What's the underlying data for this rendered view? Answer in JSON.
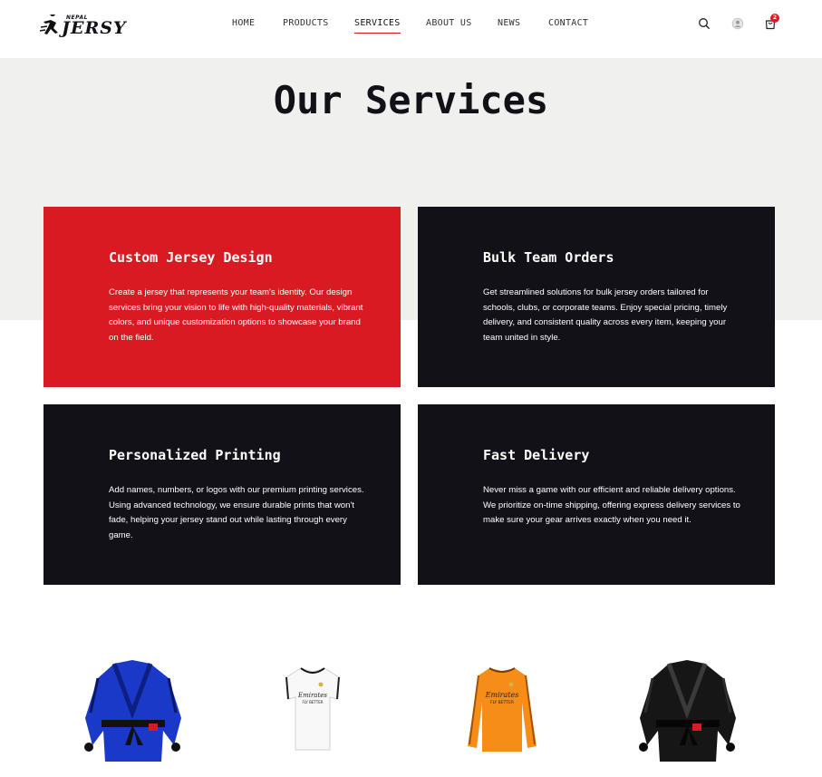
{
  "header": {
    "logo": {
      "small_text": "NEPAL",
      "brand_text": "JERSY"
    },
    "nav": [
      {
        "label": "HOME",
        "active": false
      },
      {
        "label": "PRODUCTS",
        "active": false
      },
      {
        "label": "SERVICES",
        "active": true
      },
      {
        "label": "ABOUT US",
        "active": false
      },
      {
        "label": "NEWS",
        "active": false
      },
      {
        "label": "CONTACT",
        "active": false
      }
    ],
    "icons": [
      "search-icon",
      "user-icon",
      "cart-icon"
    ],
    "cart_count": "2"
  },
  "hero": {
    "title": "Our Services"
  },
  "services": [
    {
      "title": "Custom Jersey Design",
      "description": "Create a jersey that represents your team's identity. Our design services bring your vision to life with high-quality materials, vibrant colors, and unique customization options to showcase your brand on the field."
    },
    {
      "title": "Bulk Team Orders",
      "description": "Get streamlined solutions for bulk jersey orders tailored for schools, clubs, or corporate teams. Enjoy special pricing, timely delivery, and consistent quality across every item, keeping your team united in style."
    },
    {
      "title": "Personalized Printing",
      "description": "Add names, numbers, or logos with our premium printing services. Using advanced technology, we ensure durable prints that won't fade, helping your jersey stand out while lasting through every game."
    },
    {
      "title": "Fast Delivery",
      "description": "Never miss a game with our efficient and reliable delivery options. We prioritize on-time shipping, offering express delivery services to make sure your gear arrives exactly when you need it."
    }
  ],
  "products": [
    {
      "name": "blue-gi-image"
    },
    {
      "name": "white-jersey-image",
      "print": "Emirates FLY BETTER"
    },
    {
      "name": "orange-jersey-image",
      "print": "Emirates FLY BETTER"
    },
    {
      "name": "black-gi-image"
    }
  ],
  "colors": {
    "accent": "#d81b22",
    "dark_card": "#121118",
    "hero_bg": "#f0f0ee"
  }
}
